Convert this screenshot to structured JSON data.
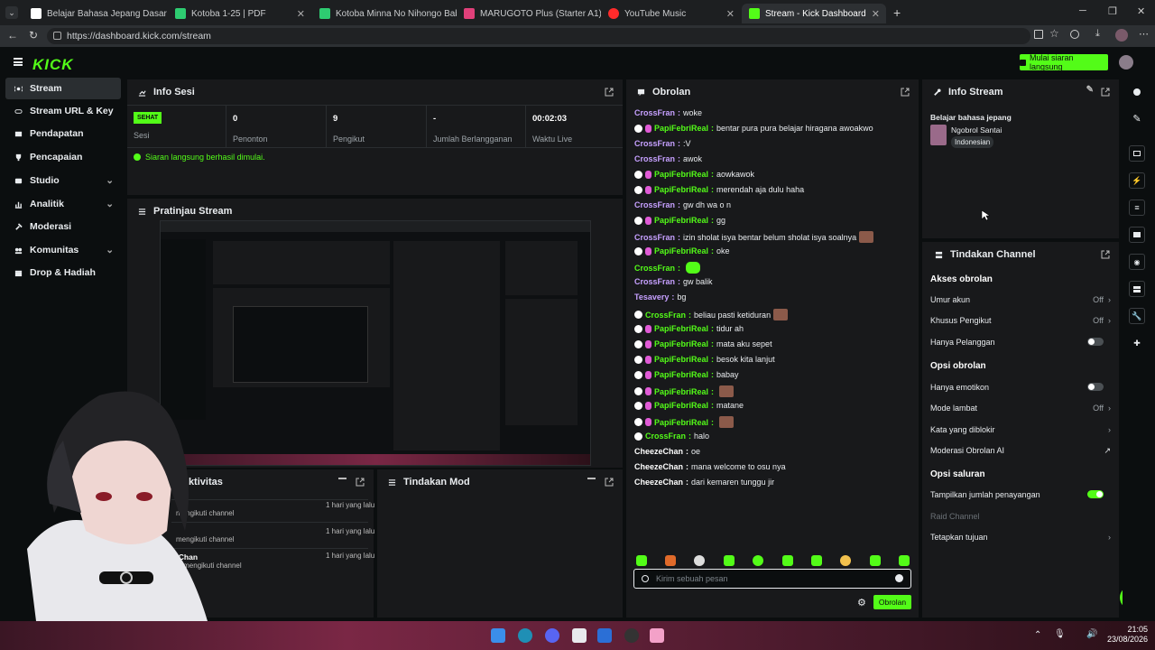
{
  "browser": {
    "tabs": [
      {
        "label": "Belajar Bahasa Jepang Dasar",
        "color": "#ffffff"
      },
      {
        "label": "Kotoba 1-25 | PDF",
        "color": "#2ecc71"
      },
      {
        "label": "Kotoba Minna No Nihongo Bab 1",
        "color": "#2ecc71"
      },
      {
        "label": "MARUGOTO Plus (Starter A1)",
        "color": "#e0407a"
      },
      {
        "label": "YouTube Music",
        "color": "#ff2b2b"
      },
      {
        "label": "Stream - Kick Dashboard",
        "color": "#53fc18"
      }
    ],
    "url": "https://dashboard.kick.com/stream"
  },
  "app": {
    "logo": "KICK",
    "go_live": "Mulai siaran langsung",
    "accent": "#53fc18"
  },
  "sidebar": {
    "items": [
      {
        "label": "Stream"
      },
      {
        "label": "Stream URL & Key"
      },
      {
        "label": "Pendapatan"
      },
      {
        "label": "Pencapaian"
      },
      {
        "label": "Studio"
      },
      {
        "label": "Analitik"
      },
      {
        "label": "Moderasi"
      },
      {
        "label": "Komunitas"
      },
      {
        "label": "Drop & Hadiah"
      }
    ]
  },
  "session": {
    "title": "Info Sesi",
    "status_badge": "SEHAT",
    "status_label": "Sesi",
    "stats": [
      {
        "value": "0",
        "label": "Penonton"
      },
      {
        "value": "9",
        "label": "Pengikut"
      },
      {
        "value": "-",
        "label": "Jumlah Berlangganan"
      },
      {
        "value": "00:02:03",
        "label": "Waktu Live"
      }
    ],
    "message": "Siaran langsung berhasil dimulai."
  },
  "preview": {
    "title": "Pratinjau Stream"
  },
  "activity": {
    "title": "Aktivitas",
    "items": [
      {
        "name": "",
        "text": "mengikuti channel",
        "time": "1 hari yang lalu"
      },
      {
        "name": "",
        "text": "mengikuti channel",
        "time": "1 hari yang lalu"
      },
      {
        "name": "CheezeChan",
        "text": "baru saja mengikuti channel",
        "time": "1 hari yang lalu"
      }
    ]
  },
  "mod_actions": {
    "title": "Tindakan Mod"
  },
  "chat": {
    "title": "Obrolan",
    "messages": [
      {
        "user": "CrossFran",
        "text": "woke",
        "cls": "u1",
        "badges": 0
      },
      {
        "user": "PapiFebriReal",
        "text": "bentar pura pura belajar hiragana awoakwo",
        "cls": "u2",
        "badges": 2
      },
      {
        "user": "CrossFran",
        "text": ":V",
        "cls": "u1",
        "badges": 0
      },
      {
        "user": "CrossFran",
        "text": "awok",
        "cls": "u1",
        "badges": 0
      },
      {
        "user": "PapiFebriReal",
        "text": "aowkawok",
        "cls": "u2",
        "badges": 2
      },
      {
        "user": "PapiFebriReal",
        "text": "merendah aja dulu haha",
        "cls": "u2",
        "badges": 2
      },
      {
        "user": "CrossFran",
        "text": "gw dh wa o n",
        "cls": "u1",
        "badges": 0
      },
      {
        "user": "PapiFebriReal",
        "text": "gg",
        "cls": "u2",
        "badges": 2
      },
      {
        "user": "CrossFran",
        "text": "izin sholat isya bentar belum sholat isya soalnya",
        "cls": "u1",
        "badges": 0
      },
      {
        "user": "PapiFebriReal",
        "text": "oke",
        "cls": "u2",
        "badges": 2
      },
      {
        "user": "CrossFran",
        "text": "",
        "cls": "u2",
        "badges": 0
      },
      {
        "user": "CrossFran",
        "text": "gw balik",
        "cls": "u1",
        "badges": 0
      },
      {
        "user": "Tesavery",
        "text": "bg",
        "cls": "u1",
        "badges": 0
      },
      {
        "user": "CrossFran",
        "text": "beliau pasti ketiduran",
        "cls": "u2",
        "badges": 1
      },
      {
        "user": "PapiFebriReal",
        "text": "tidur ah",
        "cls": "u2",
        "badges": 2
      },
      {
        "user": "PapiFebriReal",
        "text": "mata aku sepet",
        "cls": "u2",
        "badges": 2
      },
      {
        "user": "PapiFebriReal",
        "text": "besok kita lanjut",
        "cls": "u2",
        "badges": 2
      },
      {
        "user": "PapiFebriReal",
        "text": "babay",
        "cls": "u2",
        "badges": 2
      },
      {
        "user": "PapiFebriReal",
        "text": "",
        "cls": "u2",
        "badges": 2
      },
      {
        "user": "PapiFebriReal",
        "text": "matane",
        "cls": "u2",
        "badges": 2
      },
      {
        "user": "PapiFebriReal",
        "text": "",
        "cls": "u2",
        "badges": 2
      },
      {
        "user": "CrossFran",
        "text": "halo",
        "cls": "u2",
        "badges": 1
      },
      {
        "user": "CheezeChan",
        "text": "oe",
        "cls": "u3",
        "badges": 0
      },
      {
        "user": "CheezeChan",
        "text": "mana welcome to osu nya",
        "cls": "u3",
        "badges": 0
      },
      {
        "user": "CheezeChan",
        "text": "dari kemaren tunggu jir",
        "cls": "u3",
        "badges": 0
      }
    ],
    "input_placeholder": "Kirim sebuah pesan",
    "send_label": "Obrolan"
  },
  "stream_info": {
    "title": "Info Stream",
    "stream_title": "Belajar bahasa jepang",
    "category": "Ngobrol Santai",
    "tag": "Indonesian"
  },
  "channel_actions": {
    "title": "Tindakan Channel",
    "chat_access": "Akses obrolan",
    "age": "Umur akun",
    "age_value": "Off",
    "followers_only": "Khusus Pengikut",
    "followers_value": "Off",
    "subs_only": "Hanya Pelanggan",
    "chat_options": "Opsi obrolan",
    "emotes_only": "Hanya emotikon",
    "slow_mode": "Mode lambat",
    "slow_value": "Off",
    "blocked_words": "Kata yang diblokir",
    "ai_mod": "Moderasi Obrolan AI",
    "channel_options": "Opsi saluran",
    "show_viewers": "Tampilkan jumlah penayangan",
    "raid": "Raid Channel",
    "set_target": "Tetapkan tujuan"
  },
  "taskbar": {
    "time": "21:05",
    "date": "23/08/2026"
  }
}
